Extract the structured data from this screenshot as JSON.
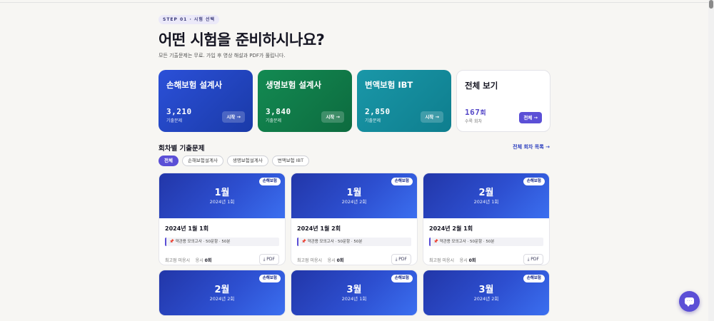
{
  "header": {
    "step_badge": "STEP 01 · 시험 선택",
    "title": "어떤 시험을 준비하시나요?",
    "subtitle": "모든 기출문제는 무료. 가입 후 영상 해설과 PDF가 풀립니다."
  },
  "categories": [
    {
      "name": "손해보험 설계사",
      "count": "3,210",
      "label": "기출문제",
      "button": "시작 →",
      "color": "#2b50d8"
    },
    {
      "name": "생명보험 설계사",
      "count": "3,840",
      "label": "기출문제",
      "button": "시작 →",
      "color": "#138a52"
    },
    {
      "name": "변액보험 IBT",
      "count": "2,850",
      "label": "기출문제",
      "button": "시작 →",
      "color": "#1a97a8"
    },
    {
      "name": "전체 보기",
      "count": "167",
      "unit": "회",
      "label": "수록 회차",
      "button": "전체 →",
      "color": "#5b4fd6"
    }
  ],
  "section": {
    "title": "회차별 기출문제",
    "all_link": "전체 회차 목록 →"
  },
  "filters": [
    "전체",
    "손해보험설계사",
    "생명보험설계사",
    "변액보험 IBT"
  ],
  "cards": [
    {
      "month": "1월",
      "sub": "2024년 1회",
      "tag": "손해보험",
      "title": "2024년 1월 1회",
      "note": "약관용 모의고사 · 50문항 · 50분",
      "recent": "최고점 미응시",
      "tries_label": "응시",
      "tries": "0회",
      "pdf": "PDF"
    },
    {
      "month": "1월",
      "sub": "2024년 2회",
      "tag": "손해보험",
      "title": "2024년 1월 2회",
      "note": "약관용 모의고사 · 50문항 · 50분",
      "recent": "최고점 미응시",
      "tries_label": "응시",
      "tries": "0회",
      "pdf": "PDF"
    },
    {
      "month": "2월",
      "sub": "2024년 1회",
      "tag": "손해보험",
      "title": "2024년 2월 1회",
      "note": "약관용 모의고사 · 50문항 · 50분",
      "recent": "최고점 미응시",
      "tries_label": "응시",
      "tries": "0회",
      "pdf": "PDF"
    },
    {
      "month": "2월",
      "sub": "2024년 2회",
      "tag": "손해보험"
    },
    {
      "month": "3월",
      "sub": "2024년 1회",
      "tag": "손해보험"
    },
    {
      "month": "3월",
      "sub": "2024년 2회",
      "tag": "손해보험"
    }
  ],
  "icons": {
    "pin": "pushpin-icon",
    "download": "download-icon",
    "chat": "chat-icon"
  },
  "colors": {
    "accent": "#5b4fd6",
    "link": "#2c3fbf"
  }
}
